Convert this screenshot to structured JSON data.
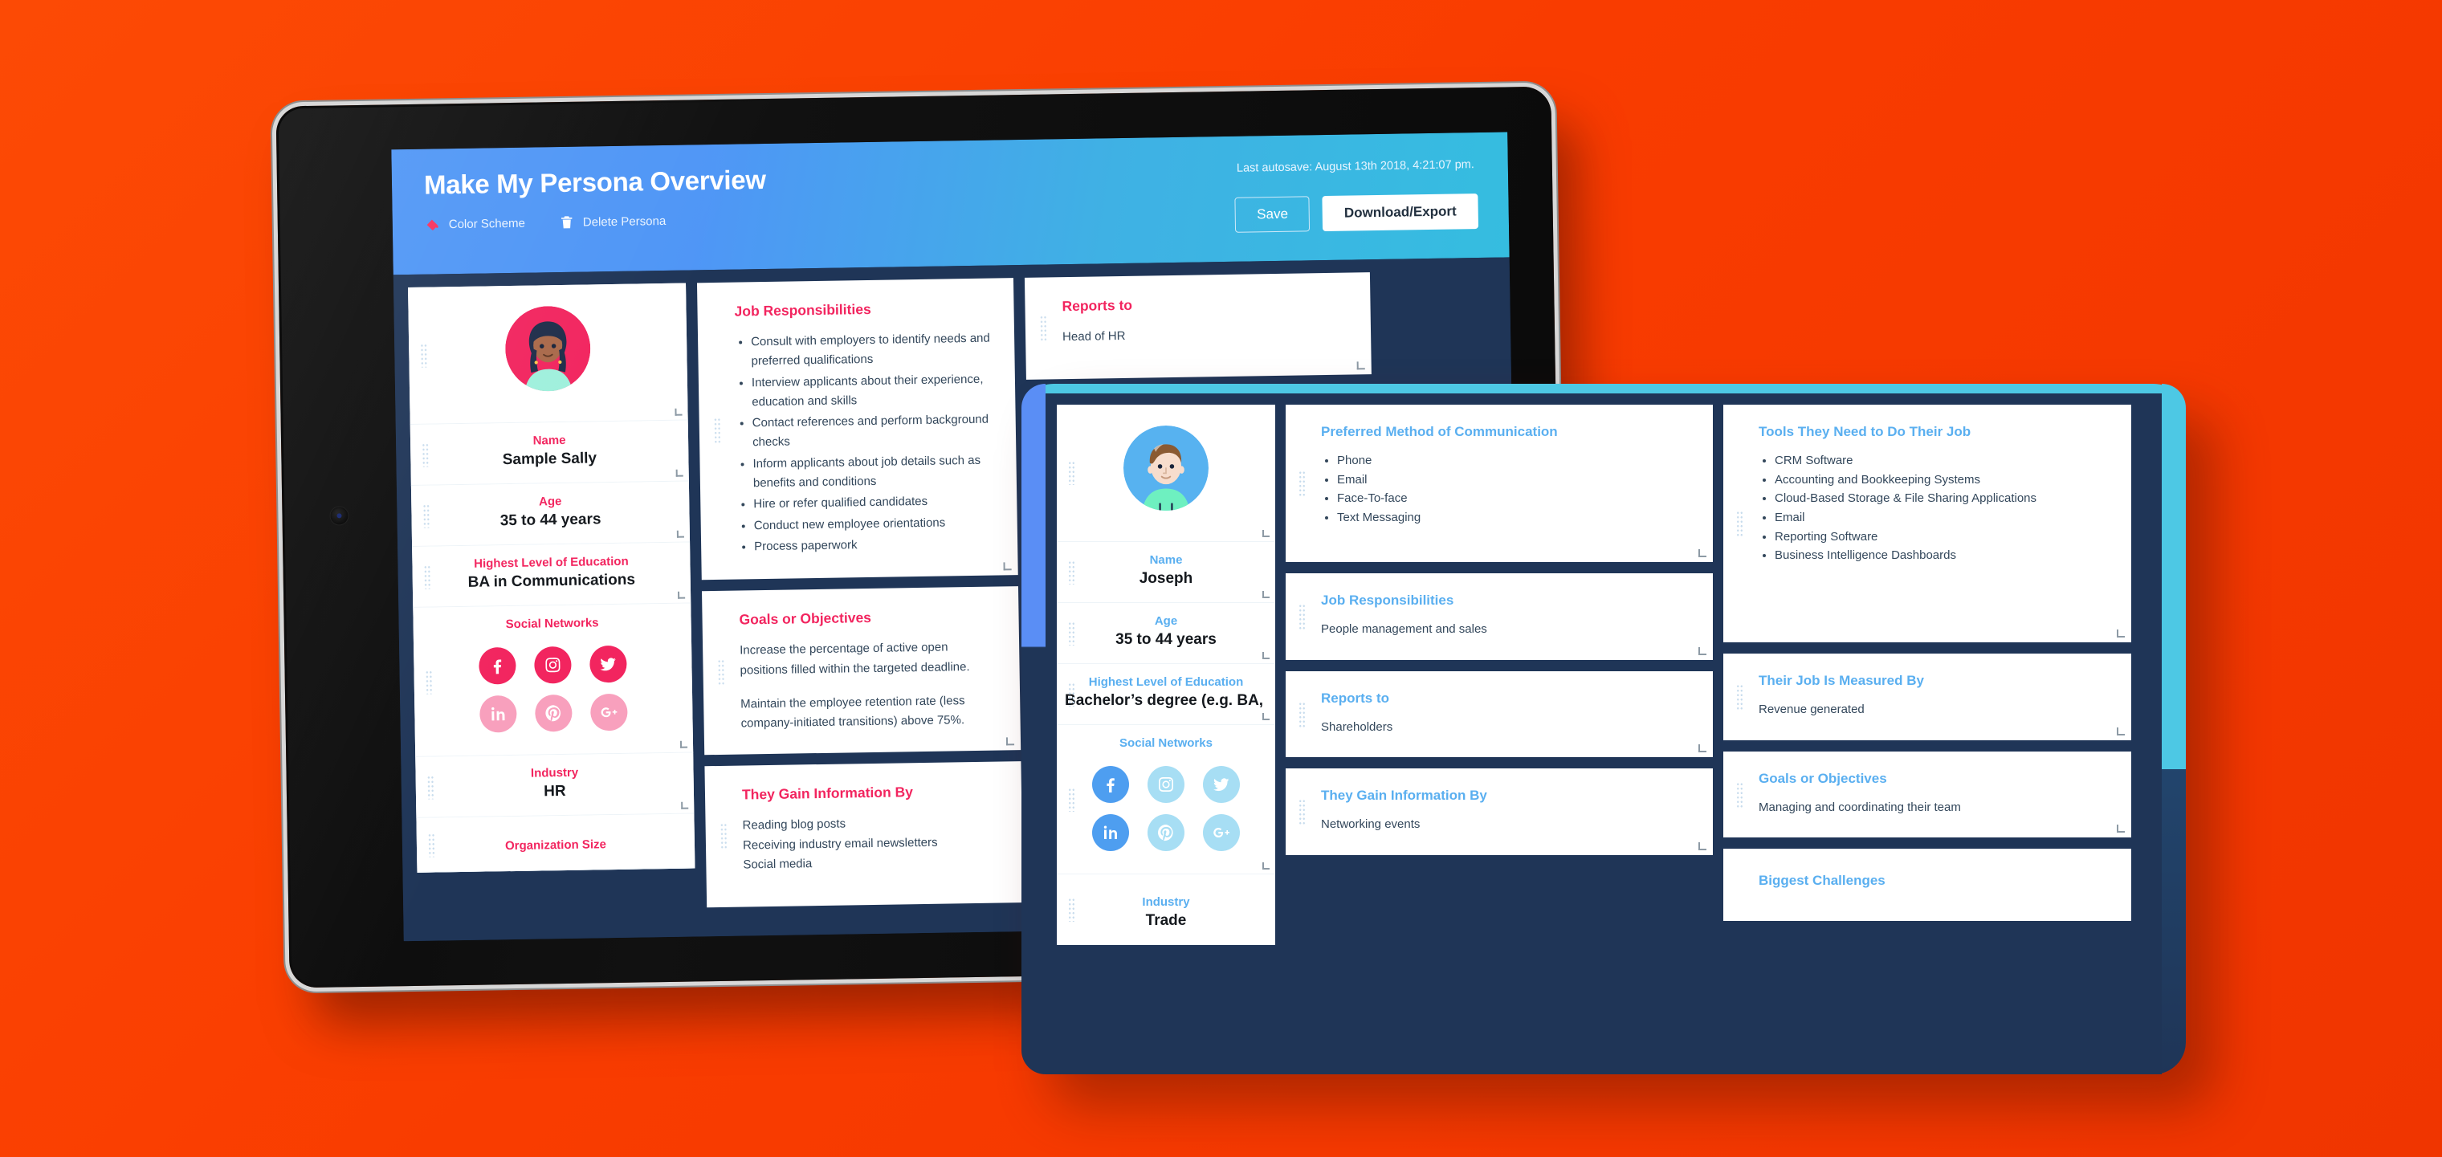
{
  "app": {
    "title": "Make My Persona Overview",
    "autosave": "Last autosave: August 13th 2018, 4:21:07 pm.",
    "actions": [
      {
        "label": "Color Scheme",
        "icon": "paint-bucket-icon"
      },
      {
        "label": "Delete Persona",
        "icon": "trash-icon"
      }
    ],
    "buttons": {
      "save": "Save",
      "download": "Download/Export"
    }
  },
  "colors": {
    "background": "#FA3C00",
    "header_start": "#4F96F6",
    "header_end": "#35BDE0",
    "board": "#1F3557",
    "accent_pink": "#F2255F",
    "accent_pink_light": "#F8A0BD",
    "accent_blue": "#5AAFF0",
    "accent_blue_light": "#A7DEF4",
    "bezel_teal": "#4DC8E4"
  },
  "persona_sally": {
    "avatar_label": "avatar-sally",
    "fields": [
      {
        "label": "Name",
        "value": "Sample Sally"
      },
      {
        "label": "Age",
        "value": "35 to 44 years"
      },
      {
        "label": "Highest Level of Education",
        "value": "BA in Communications"
      },
      {
        "label": "Industry",
        "value": "HR"
      },
      {
        "label": "Organization Size",
        "value": ""
      }
    ],
    "social_label": "Social Networks",
    "social": [
      {
        "name": "facebook-icon",
        "tone": "s1"
      },
      {
        "name": "instagram-icon",
        "tone": "s1"
      },
      {
        "name": "twitter-icon",
        "tone": "s1"
      },
      {
        "name": "linkedin-icon",
        "tone": "s2"
      },
      {
        "name": "pinterest-icon",
        "tone": "s2"
      },
      {
        "name": "googleplus-icon",
        "tone": "s2"
      }
    ],
    "cards": {
      "job_responsibilities": {
        "title": "Job Responsibilities",
        "items": [
          "Consult with employers to identify needs and preferred qualifications",
          "Interview applicants about their experience, education and skills",
          "Contact references and perform background checks",
          "Inform applicants about job details such as benefits and conditions",
          "Hire or refer qualified candidates",
          "Conduct new employee orientations",
          "Process paperwork"
        ]
      },
      "goals": {
        "title": "Goals or Objectives",
        "paragraphs": [
          "Increase the percentage of active open positions filled within the targeted deadline.",
          "Maintain the employee retention rate (less company-initiated transitions) above 75%."
        ]
      },
      "gain_info": {
        "title": "They Gain Information By",
        "lines": [
          "Reading blog posts",
          "Receiving industry email newsletters",
          "Social media"
        ]
      },
      "reports_to": {
        "title": "Reports to",
        "value": "Head of HR"
      }
    }
  },
  "persona_joseph": {
    "avatar_label": "avatar-joseph",
    "fields": [
      {
        "label": "Name",
        "value": "Joseph"
      },
      {
        "label": "Age",
        "value": "35 to 44 years"
      },
      {
        "label": "Highest Level of Education",
        "value": "Bachelor’s degree (e.g. BA, B·"
      },
      {
        "label": "Industry",
        "value": "Trade"
      }
    ],
    "social_label": "Social Networks",
    "social": [
      {
        "name": "facebook-icon",
        "tone": "s1"
      },
      {
        "name": "instagram-icon",
        "tone": "s2"
      },
      {
        "name": "twitter-icon",
        "tone": "s2"
      },
      {
        "name": "linkedin-icon",
        "tone": "s1"
      },
      {
        "name": "pinterest-icon",
        "tone": "s2"
      },
      {
        "name": "googleplus-icon",
        "tone": "s2"
      }
    ],
    "cards": {
      "communication": {
        "title": "Preferred Method of Communication",
        "items": [
          "Phone",
          "Email",
          "Face-To-face",
          "Text Messaging"
        ]
      },
      "tools": {
        "title": "Tools They Need to Do Their Job",
        "items": [
          "CRM Software",
          "Accounting and Bookkeeping Systems",
          "Cloud-Based Storage & File Sharing Applications",
          "Email",
          "Reporting Software",
          "Business Intelligence Dashboards"
        ]
      },
      "job_responsibilities": {
        "title": "Job Responsibilities",
        "value": "People management and sales"
      },
      "reports_to": {
        "title": "Reports to",
        "value": "Shareholders"
      },
      "measured_by": {
        "title": "Their Job Is Measured By",
        "value": "Revenue generated"
      },
      "goals": {
        "title": "Goals or Objectives",
        "value": "Managing and coordinating their team"
      },
      "gain_info": {
        "title": "They Gain Information By",
        "value": "Networking events"
      },
      "challenges": {
        "title": "Biggest Challenges",
        "value": ""
      }
    }
  }
}
